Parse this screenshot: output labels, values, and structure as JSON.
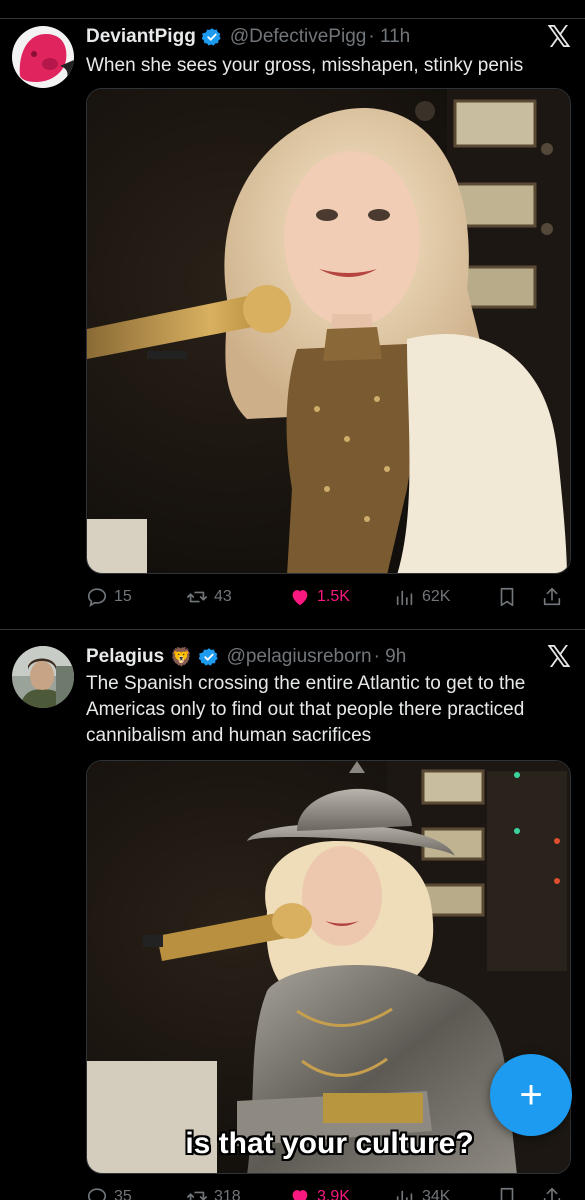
{
  "tweets": [
    {
      "name": "DeviantPigg",
      "handle": "@DefectivePigg",
      "time": "· 11h",
      "text": "When she sees your gross, misshapen, stinky penis",
      "replies": "15",
      "retweets": "43",
      "likes": "1.5K",
      "views": "62K"
    },
    {
      "name": "Pelagius",
      "emoji": "🦁",
      "handle": "@pelagiusreborn",
      "time": "· 9h",
      "text": "The Spanish crossing the entire Atlantic to get to the Americas only to find out that people there practiced cannibalism and human sacrifices",
      "caption": "is that your culture?",
      "replies": "35",
      "retweets": "318",
      "likes": "3.9K",
      "views": "34K"
    }
  ],
  "x_logo": "𝕏",
  "fab_label": "+",
  "colors": {
    "accent": "#1d9bf0",
    "like": "#f91880",
    "muted": "#71767b"
  }
}
